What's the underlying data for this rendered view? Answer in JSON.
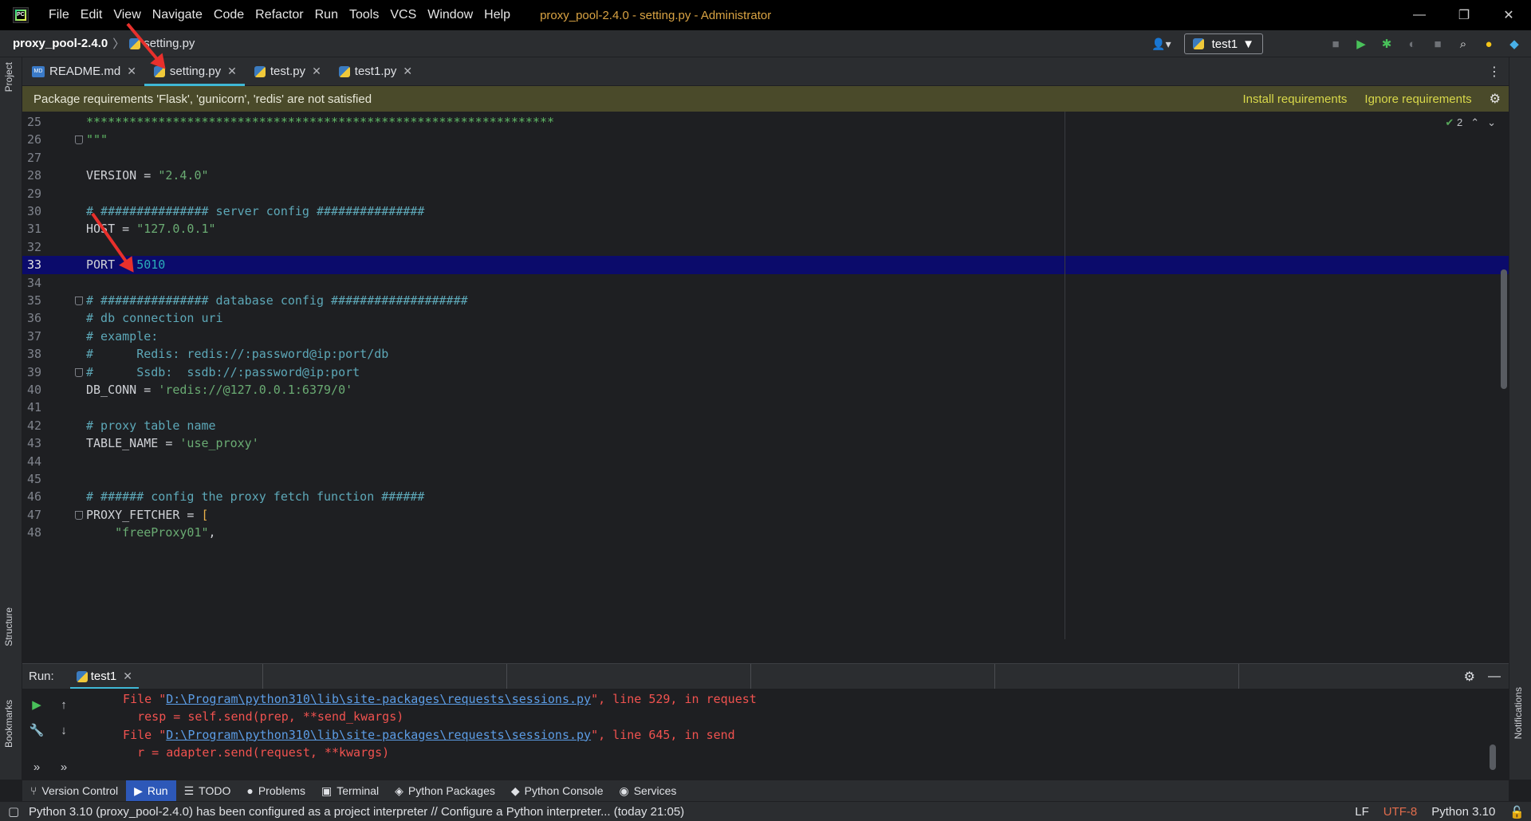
{
  "titlebar": {
    "menus": [
      "File",
      "Edit",
      "View",
      "Navigate",
      "Code",
      "Refactor",
      "Run",
      "Tools",
      "VCS",
      "Window",
      "Help"
    ],
    "window_title": "proxy_pool-2.4.0 - setting.py - Administrator"
  },
  "navbar": {
    "project": "proxy_pool-2.4.0",
    "file": "setting.py",
    "run_config": "test1"
  },
  "left_strip": {
    "project": "Project",
    "structure": "Structure",
    "bookmarks": "Bookmarks"
  },
  "right_strip": {
    "notifications": "Notifications"
  },
  "tabs": [
    {
      "label": "README.md",
      "icon": "markdown-icon",
      "active": false
    },
    {
      "label": "setting.py",
      "icon": "python-file-icon",
      "active": true
    },
    {
      "label": "test.py",
      "icon": "python-file-icon",
      "active": false
    },
    {
      "label": "test1.py",
      "icon": "python-file-icon",
      "active": false
    }
  ],
  "banner": {
    "text": "Package requirements 'Flask', 'gunicorn', 'redis' are not satisfied",
    "install": "Install requirements",
    "ignore": "Ignore requirements"
  },
  "editor": {
    "inspection_count": "2",
    "current_line": 33,
    "lines": [
      {
        "n": "25",
        "segments": [
          {
            "t": "*****************************************************************",
            "c": "c-green"
          }
        ]
      },
      {
        "n": "26",
        "segments": [
          {
            "t": "\"\"\"",
            "c": "c-green"
          }
        ],
        "fold": true
      },
      {
        "n": "27",
        "segments": []
      },
      {
        "n": "28",
        "segments": [
          {
            "t": "VERSION = ",
            "c": ""
          },
          {
            "t": "\"2.4.0\"",
            "c": "c-string"
          }
        ]
      },
      {
        "n": "29",
        "segments": []
      },
      {
        "n": "30",
        "segments": [
          {
            "t": "# ############### server config ###############",
            "c": "c-comment"
          }
        ]
      },
      {
        "n": "31",
        "segments": [
          {
            "t": "HOST = ",
            "c": ""
          },
          {
            "t": "\"127.0.0.1\"",
            "c": "c-string"
          }
        ]
      },
      {
        "n": "32",
        "segments": []
      },
      {
        "n": "33",
        "segments": [
          {
            "t": "PORT = ",
            "c": ""
          },
          {
            "t": "5010",
            "c": "c-number"
          }
        ]
      },
      {
        "n": "34",
        "segments": []
      },
      {
        "n": "35",
        "segments": [
          {
            "t": "# ############### database config ###################",
            "c": "c-comment"
          }
        ],
        "fold": true
      },
      {
        "n": "36",
        "segments": [
          {
            "t": "# db connection uri",
            "c": "c-comment"
          }
        ]
      },
      {
        "n": "37",
        "segments": [
          {
            "t": "# example:",
            "c": "c-comment"
          }
        ]
      },
      {
        "n": "38",
        "segments": [
          {
            "t": "#      Redis: redis://:password@ip:port/db",
            "c": "c-comment"
          }
        ]
      },
      {
        "n": "39",
        "segments": [
          {
            "t": "#      Ssdb:  ssdb://:password@ip:port",
            "c": "c-comment"
          }
        ],
        "fold": true
      },
      {
        "n": "40",
        "segments": [
          {
            "t": "DB_CONN = ",
            "c": ""
          },
          {
            "t": "'redis://@127.0.0.1:6379/0'",
            "c": "c-string"
          }
        ]
      },
      {
        "n": "41",
        "segments": []
      },
      {
        "n": "42",
        "segments": [
          {
            "t": "# proxy table name",
            "c": "c-comment"
          }
        ]
      },
      {
        "n": "43",
        "segments": [
          {
            "t": "TABLE_NAME = ",
            "c": ""
          },
          {
            "t": "'use_proxy'",
            "c": "c-string"
          }
        ]
      },
      {
        "n": "44",
        "segments": []
      },
      {
        "n": "45",
        "segments": []
      },
      {
        "n": "46",
        "segments": [
          {
            "t": "# ###### config the proxy fetch function ######",
            "c": "c-comment"
          }
        ]
      },
      {
        "n": "47",
        "segments": [
          {
            "t": "PROXY_FETCHER = ",
            "c": ""
          },
          {
            "t": "[",
            "c": "c-bracket"
          }
        ],
        "fold": true
      },
      {
        "n": "48",
        "segments": [
          {
            "t": "    ",
            "c": ""
          },
          {
            "t": "\"freeProxy01\"",
            "c": "c-string"
          },
          {
            "t": ",",
            "c": ""
          }
        ]
      }
    ]
  },
  "run_panel": {
    "label": "Run:",
    "tab": "test1",
    "console": [
      {
        "pre": "  File \"",
        "link": "D:\\Program\\python310\\lib\\site-packages\\requests\\sessions.py",
        "post": "\", line 529, in request"
      },
      {
        "pre": "    resp = self.send(prep, **send_kwargs)",
        "link": "",
        "post": ""
      },
      {
        "pre": "  File \"",
        "link": "D:\\Program\\python310\\lib\\site-packages\\requests\\sessions.py",
        "post": "\", line 645, in send"
      },
      {
        "pre": "    r = adapter.send(request, **kwargs)",
        "link": "",
        "post": ""
      }
    ]
  },
  "bottom_tabs": [
    {
      "label": "Version Control",
      "icon": "branch-icon",
      "glyph": "⑂",
      "active": false
    },
    {
      "label": "Run",
      "icon": "run-icon",
      "glyph": "▶",
      "active": true
    },
    {
      "label": "TODO",
      "icon": "todo-icon",
      "glyph": "☰",
      "active": false
    },
    {
      "label": "Problems",
      "icon": "problems-icon",
      "glyph": "●",
      "active": false
    },
    {
      "label": "Terminal",
      "icon": "terminal-icon",
      "glyph": "▣",
      "active": false
    },
    {
      "label": "Python Packages",
      "icon": "packages-icon",
      "glyph": "◈",
      "active": false
    },
    {
      "label": "Python Console",
      "icon": "python-console-icon",
      "glyph": "◆",
      "active": false
    },
    {
      "label": "Services",
      "icon": "services-icon",
      "glyph": "◉",
      "active": false
    }
  ],
  "statusbar": {
    "message": "Python 3.10 (proxy_pool-2.4.0) has been configured as a project interpreter // Configure a Python interpreter... (today 21:05)",
    "line_sep": "LF",
    "encoding": "UTF-8",
    "interpreter": "Python 3.10"
  }
}
